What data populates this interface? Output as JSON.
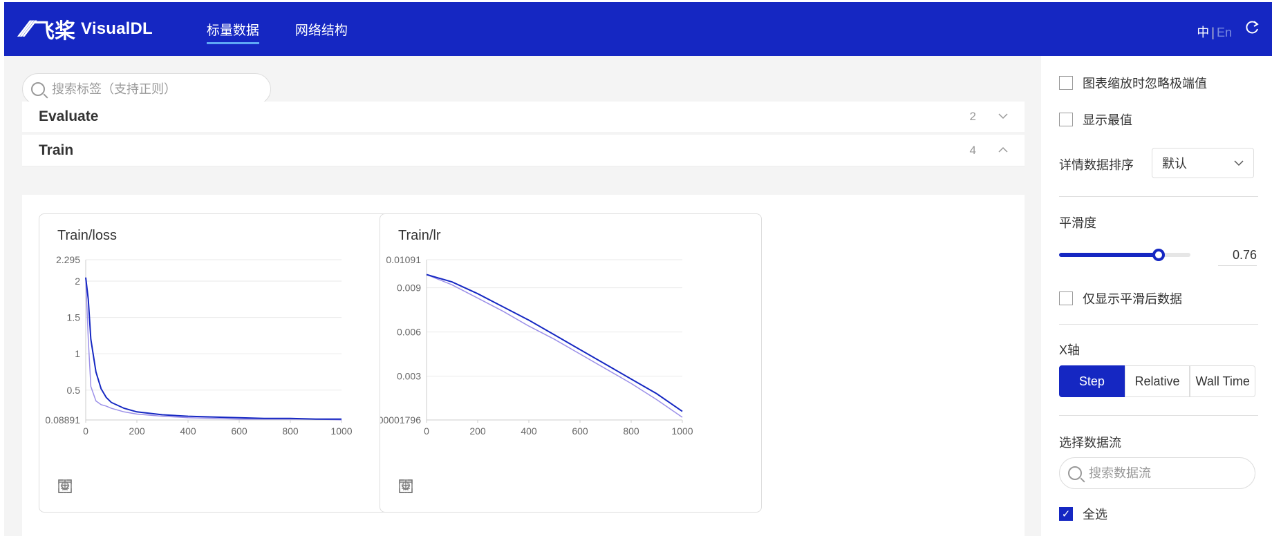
{
  "header": {
    "logo_pp": "⁄⁄⁄",
    "logo_feijiang": "飞桨",
    "logo_app": "VisualDL",
    "nav": [
      {
        "label": "标量数据",
        "active": true
      },
      {
        "label": "网络结构",
        "active": false
      }
    ],
    "lang_zh": "中",
    "lang_sep": "|",
    "lang_en": "En",
    "refresh_icon": "refresh-icon",
    "brand_color": "#1527c2"
  },
  "main": {
    "search_placeholder": "搜索标签（支持正则）",
    "groups": [
      {
        "name": "Evaluate",
        "count": "2",
        "expanded": false
      },
      {
        "name": "Train",
        "count": "4",
        "expanded": true
      }
    ]
  },
  "chart_data": [
    {
      "type": "line",
      "title": "Train/loss",
      "xlabel": "",
      "ylabel": "",
      "xlim": [
        0,
        1000
      ],
      "ylim": [
        0.08891,
        2.295
      ],
      "x_ticks": [
        "0",
        "200",
        "400",
        "600",
        "800",
        "1000"
      ],
      "y_ticks": [
        "2.295",
        "2",
        "1.5",
        "1",
        "0.5",
        "0.08891"
      ],
      "grid": true,
      "series": [
        {
          "color": "#9b8fe8",
          "x": [
            0,
            10,
            20,
            40,
            60,
            80,
            100,
            150,
            200,
            300,
            400,
            500,
            600,
            700,
            800,
            900,
            1000
          ],
          "values": [
            2.05,
            1.2,
            0.55,
            0.35,
            0.3,
            0.28,
            0.25,
            0.2,
            0.17,
            0.14,
            0.12,
            0.11,
            0.1,
            0.1,
            0.1,
            0.1,
            0.09
          ]
        },
        {
          "color": "#1527c2",
          "x": [
            0,
            10,
            20,
            40,
            60,
            80,
            100,
            150,
            200,
            300,
            400,
            500,
            600,
            700,
            800,
            900,
            1000
          ],
          "values": [
            2.05,
            1.75,
            1.2,
            0.75,
            0.52,
            0.4,
            0.33,
            0.25,
            0.2,
            0.16,
            0.14,
            0.13,
            0.12,
            0.11,
            0.11,
            0.1,
            0.1
          ]
        }
      ]
    },
    {
      "type": "line",
      "title": "Train/lr",
      "xlabel": "",
      "ylabel": "",
      "xlim": [
        0,
        1000
      ],
      "ylim": [
        1.796e-05,
        0.01091
      ],
      "x_ticks": [
        "0",
        "200",
        "400",
        "600",
        "800",
        "1000"
      ],
      "y_ticks": [
        "0.01091",
        "0.009",
        "0.006",
        "0.003",
        "00001796"
      ],
      "grid": true,
      "series": [
        {
          "color": "#9b8fe8",
          "x": [
            0,
            100,
            200,
            300,
            400,
            500,
            600,
            700,
            800,
            900,
            1000
          ],
          "values": [
            0.0099,
            0.0092,
            0.0083,
            0.0074,
            0.0064,
            0.0055,
            0.0045,
            0.0035,
            0.0025,
            0.0014,
            0.0002
          ]
        },
        {
          "color": "#1527c2",
          "x": [
            0,
            100,
            200,
            300,
            400,
            500,
            600,
            700,
            800,
            900,
            1000
          ],
          "values": [
            0.0099,
            0.0094,
            0.0086,
            0.0077,
            0.0068,
            0.0058,
            0.0048,
            0.0038,
            0.0028,
            0.0018,
            0.0006
          ]
        }
      ]
    }
  ],
  "chart_tools": [
    "fullscreen-icon",
    "restore-icon",
    "filter-icon",
    "download-icon"
  ],
  "sidebar": {
    "ignore_outliers": {
      "label": "图表缩放时忽略极端值",
      "checked": false
    },
    "show_extremes": {
      "label": "显示最值",
      "checked": false
    },
    "sort_label": "详情数据排序",
    "sort_value": "默认",
    "smoothing_label": "平滑度",
    "smoothing_value": "0.76",
    "smoothing_fraction": 0.76,
    "only_smoothed": {
      "label": "仅显示平滑后数据",
      "checked": false
    },
    "xaxis_label": "X轴",
    "xaxis_options": [
      {
        "label": "Step",
        "selected": true
      },
      {
        "label": "Relative",
        "selected": false
      },
      {
        "label": "Wall Time",
        "selected": false
      }
    ],
    "stream_label": "选择数据流",
    "stream_search_placeholder": "搜索数据流",
    "select_all": {
      "label": "全选",
      "checked": true
    }
  }
}
